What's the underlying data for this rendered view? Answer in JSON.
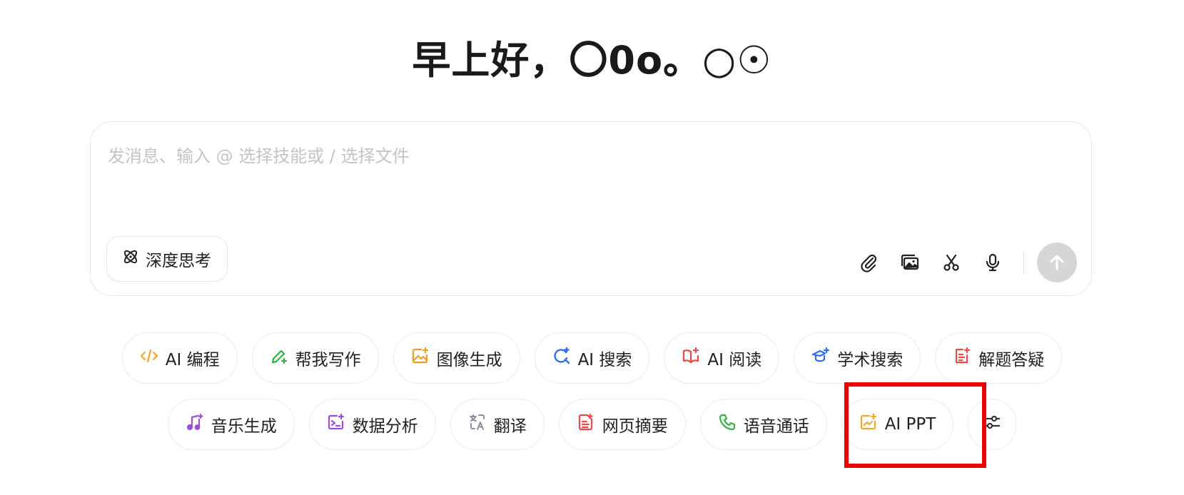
{
  "greeting": "早上好，〇0o。○☉",
  "composer": {
    "placeholder": "发消息、输入 @ 选择技能或 / 选择文件",
    "deep_think_label": "深度思考",
    "tools": [
      "paperclip-icon",
      "image-icon",
      "scissors-icon",
      "microphone-icon"
    ],
    "send_icon": "arrow-up-icon"
  },
  "chips_row1": [
    {
      "label": "AI 编程",
      "icon": "code-icon",
      "color": "#f5a623"
    },
    {
      "label": "帮我写作",
      "icon": "pen-sparkle-icon",
      "color": "#2fb344"
    },
    {
      "label": "图像生成",
      "icon": "image-sparkle-icon",
      "color": "#f59a23"
    },
    {
      "label": "AI 搜索",
      "icon": "search-sparkle-icon",
      "color": "#2b6ff2"
    },
    {
      "label": "AI 阅读",
      "icon": "book-sparkle-icon",
      "color": "#f04747"
    },
    {
      "label": "学术搜索",
      "icon": "graduation-cap-icon",
      "color": "#2b6ff2"
    },
    {
      "label": "解题答疑",
      "icon": "notepad-sparkle-icon",
      "color": "#f04747"
    }
  ],
  "chips_row2": [
    {
      "label": "音乐生成",
      "icon": "music-note-icon",
      "color": "#9b4dde"
    },
    {
      "label": "数据分析",
      "icon": "chart-sparkle-icon",
      "color": "#9b4dde"
    },
    {
      "label": "翻译",
      "icon": "translate-icon",
      "color": "#8a8fa0"
    },
    {
      "label": "网页摘要",
      "icon": "document-icon",
      "color": "#f04747"
    },
    {
      "label": "语音通话",
      "icon": "phone-icon",
      "color": "#2fb344"
    },
    {
      "label": "AI PPT",
      "icon": "presentation-sparkle-icon",
      "color": "#f5a623"
    }
  ],
  "settings_icon": "sliders-icon",
  "highlight_color": "#ee0000"
}
